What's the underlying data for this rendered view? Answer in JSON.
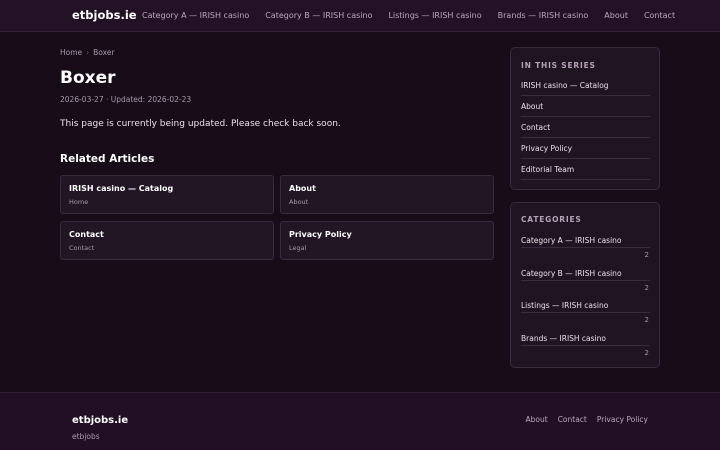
{
  "header": {
    "brand": "etbjobs.ie",
    "nav": [
      "Category A — IRISH casino",
      "Category B — IRISH casino",
      "Listings — IRISH casino",
      "Brands — IRISH casino",
      "About",
      "Contact"
    ]
  },
  "breadcrumb": {
    "home": "Home",
    "current": "Boxer",
    "sep": "›"
  },
  "article": {
    "title": "Boxer",
    "meta": "2026-03-27 · Updated: 2026-02-23",
    "body": "This page is currently being updated. Please check back soon."
  },
  "related": {
    "heading": "Related Articles",
    "items": [
      {
        "title": "IRISH casino — Catalog",
        "sub": "Home"
      },
      {
        "title": "About",
        "sub": "About"
      },
      {
        "title": "Contact",
        "sub": "Contact"
      },
      {
        "title": "Privacy Policy",
        "sub": "Legal"
      }
    ]
  },
  "series": {
    "heading": "IN THIS SERIES",
    "items": [
      "IRISH casino — Catalog",
      "About",
      "Contact",
      "Privacy Policy",
      "Editorial Team"
    ]
  },
  "categories": {
    "heading": "CATEGORIES",
    "items": [
      {
        "label": "Category A — IRISH casino",
        "count": "2"
      },
      {
        "label": "Category B — IRISH casino",
        "count": "2"
      },
      {
        "label": "Listings — IRISH casino",
        "count": "2"
      },
      {
        "label": "Brands — IRISH casino",
        "count": "2"
      }
    ]
  },
  "footer": {
    "brand": "etbjobs.ie",
    "sub": "etbjobs",
    "links": [
      "About",
      "Contact",
      "Privacy Policy"
    ]
  }
}
